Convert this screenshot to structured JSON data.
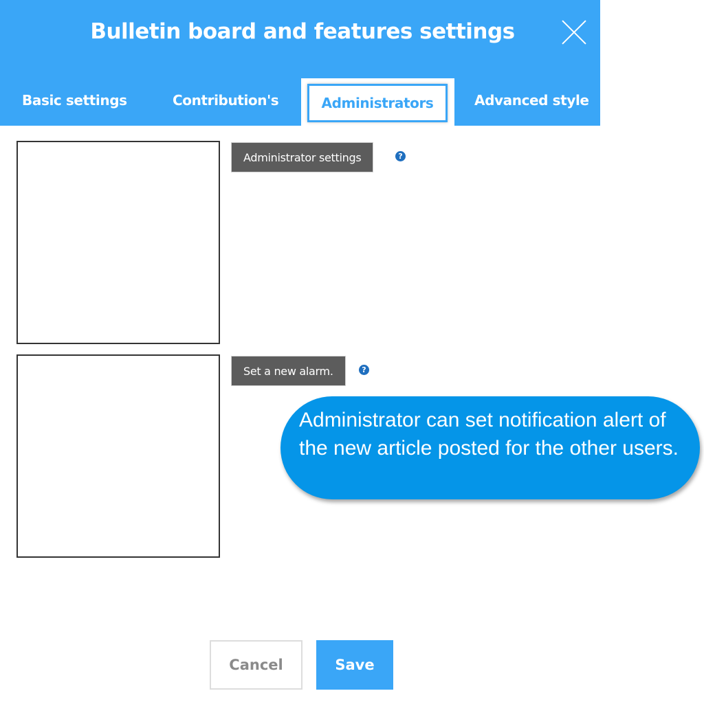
{
  "dialog": {
    "title": "Bulletin board and features settings",
    "close_icon": "close-x-icon"
  },
  "tabs": [
    {
      "label": "Basic settings",
      "active": false
    },
    {
      "label": "Contribution's",
      "active": false
    },
    {
      "label": "Administrators",
      "active": true
    },
    {
      "label": "Advanced style",
      "active": false
    }
  ],
  "sections": [
    {
      "label": "Administrator settings",
      "help_icon": "?"
    },
    {
      "label": "Set a new alarm.",
      "help_icon": "?"
    }
  ],
  "callout": {
    "text": "Administrator can set notification alert of the new article posted for the other users."
  },
  "footer": {
    "cancel_label": "Cancel",
    "save_label": "Save"
  },
  "colors": {
    "accent": "#3aa6f7",
    "callout": "#0595e8",
    "label_bg": "#5c5c5c"
  }
}
